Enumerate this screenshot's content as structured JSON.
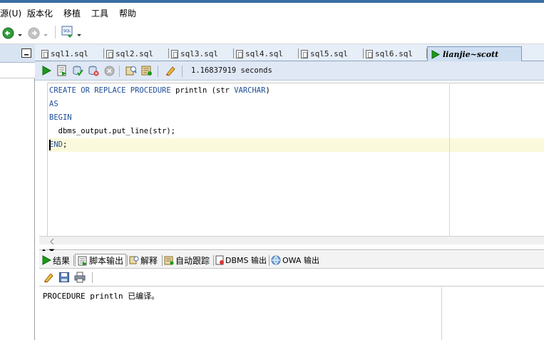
{
  "menubar": {
    "items": [
      "源(U)",
      "版本化",
      "移植",
      "工具",
      "帮助"
    ]
  },
  "editor_tabs": [
    {
      "label": "sql1.sql"
    },
    {
      "label": "sql2.sql"
    },
    {
      "label": "sql3.sql"
    },
    {
      "label": "sql4.sql"
    },
    {
      "label": "sql5.sql"
    },
    {
      "label": "sql6.sql"
    }
  ],
  "active_tab": {
    "label": "lianjie~scott"
  },
  "editor_toolbar": {
    "execution_time": "1.16837919 seconds"
  },
  "code": {
    "line1_kw1": "CREATE OR REPLACE PROCEDURE",
    "line1_rest": " println (str ",
    "line1_kw2": "VARCHAR",
    "line1_end": ")",
    "line2": "AS",
    "line3": "BEGIN",
    "line4": "  dbms_output.put_line(str);",
    "line5_kw": "END",
    "line5_end": ";"
  },
  "output_tabs": [
    {
      "label": "结果"
    },
    {
      "label": "脚本输出"
    },
    {
      "label": "解释"
    },
    {
      "label": "自动跟踪"
    },
    {
      "label": "DBMS 输出"
    },
    {
      "label": "OWA 输出"
    }
  ],
  "output": {
    "message": "PROCEDURE println 已编译。"
  },
  "colors": {
    "keyword": "#1f4e99",
    "current_line": "#fbf9dc",
    "run_green": "#1a9a1a"
  }
}
